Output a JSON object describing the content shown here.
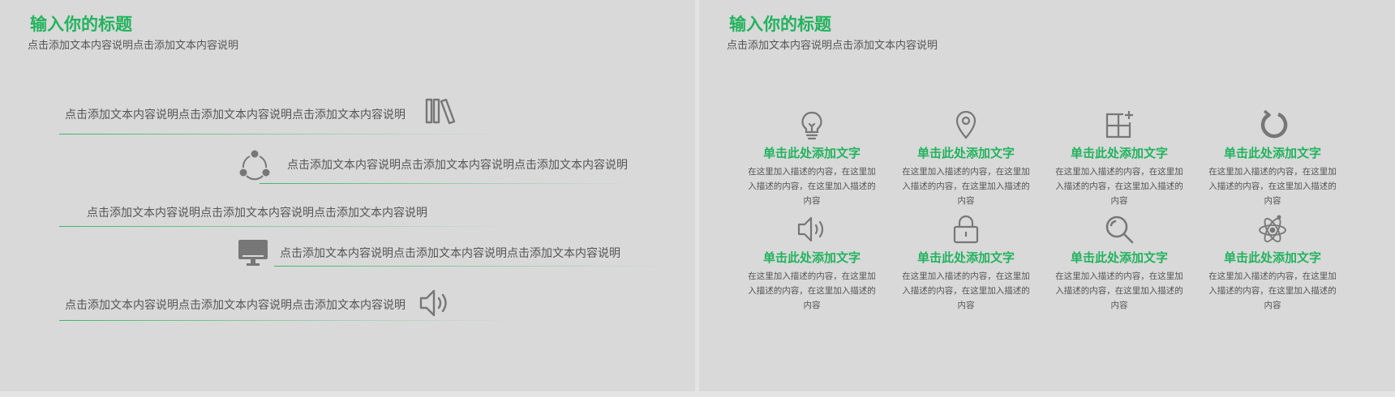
{
  "left": {
    "title": "输入你的标题",
    "subtitle": "点击添加文本内容说明点击添加文本内容说明",
    "rows": [
      {
        "text": "点击添加文本内容说明点击添加文本内容说明点击添加文本内容说明",
        "icon": "books-icon"
      },
      {
        "text": "点击添加文本内容说明点击添加文本内容说明点击添加文本内容说明",
        "icon": "share-cycle-icon"
      },
      {
        "text": "点击添加文本内容说明点击添加文本内容说明点击添加文本内容说明",
        "icon": ""
      },
      {
        "text": "点击添加文本内容说明点击添加文本内容说明点击添加文本内容说明",
        "icon": "monitor-icon"
      },
      {
        "text": "点击添加文本内容说明点击添加文本内容说明点击添加文本内容说明",
        "icon": "speaker-icon"
      }
    ]
  },
  "right": {
    "title": "输入你的标题",
    "subtitle": "点击添加文本内容说明点击添加文本内容说明",
    "features": [
      {
        "icon": "lightbulb-icon",
        "title": "单击此处添加文字",
        "desc": "在这里加入描述的内容，在这里加入描述的内容，在这里加入描述的内容"
      },
      {
        "icon": "location-pin-icon",
        "title": "单击此处添加文字",
        "desc": "在这里加入描述的内容，在这里加入描述的内容，在这里加入描述的内容"
      },
      {
        "icon": "grid-add-icon",
        "title": "单击此处添加文字",
        "desc": "在这里加入描述的内容，在这里加入描述的内容，在这里加入描述的内容"
      },
      {
        "icon": "refresh-icon",
        "title": "单击此处添加文字",
        "desc": "在这里加入描述的内容，在这里加入描述的内容，在这里加入描述的内容"
      },
      {
        "icon": "speaker-icon",
        "title": "单击此处添加文字",
        "desc": "在这里加入描述的内容，在这里加入描述的内容，在这里加入描述的内容"
      },
      {
        "icon": "lock-icon",
        "title": "单击此处添加文字",
        "desc": "在这里加入描述的内容，在这里加入描述的内容，在这里加入描述的内容"
      },
      {
        "icon": "search-icon",
        "title": "单击此处添加文字",
        "desc": "在这里加入描述的内容，在这里加入描述的内容，在这里加入描述的内容"
      },
      {
        "icon": "atom-icon",
        "title": "单击此处添加文字",
        "desc": "在这里加入描述的内容，在这里加入描述的内容，在这里加入描述的内容"
      }
    ]
  },
  "colors": {
    "accent": "#22b35e",
    "text": "#555555",
    "icon": "#777777",
    "background": "#d9d9d9"
  }
}
